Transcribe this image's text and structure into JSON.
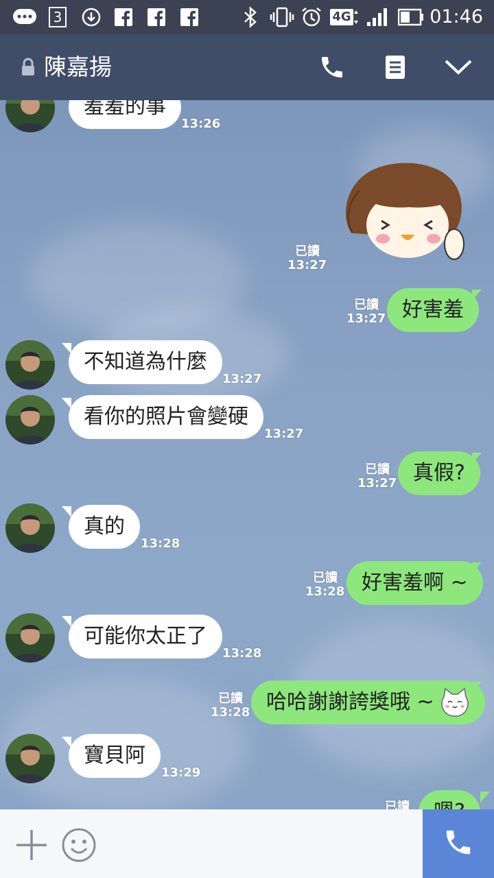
{
  "status_bar": {
    "time": "01:46",
    "network": "4G",
    "notification_count": "3",
    "icons": [
      "chat-icon",
      "sim-3-icon",
      "download-icon",
      "facebook-icon",
      "facebook-icon",
      "facebook-icon",
      "bluetooth-icon",
      "vibrate-icon",
      "alarm-icon",
      "network-4g-icon",
      "signal-icon",
      "battery-icon"
    ]
  },
  "header": {
    "contact_name": "陳嘉揚",
    "icons": [
      "lock-icon",
      "phone-icon",
      "note-icon",
      "chevron-down-icon"
    ]
  },
  "colors": {
    "header_bg": "#3f4d69",
    "status_bg": "#3b4254",
    "incoming_bubble": "#ffffff",
    "outgoing_bubble": "#8de77c",
    "call_button": "#5b86d8"
  },
  "messages": [
    {
      "from": "them",
      "text": "羞羞的事",
      "time": "13:26"
    },
    {
      "from": "me",
      "type": "sticker",
      "sticker": "shy-girl-sticker",
      "read": "已讀",
      "time": "13:27"
    },
    {
      "from": "me",
      "text": "好害羞",
      "read": "已讀",
      "time": "13:27"
    },
    {
      "from": "them",
      "text": "不知道為什麼",
      "time": "13:27"
    },
    {
      "from": "them",
      "text": "看你的照片會變硬",
      "time": "13:27"
    },
    {
      "from": "me",
      "text": "真假?",
      "read": "已讀",
      "time": "13:27"
    },
    {
      "from": "them",
      "text": "真的",
      "time": "13:28"
    },
    {
      "from": "me",
      "text": "好害羞啊 ~",
      "read": "已讀",
      "time": "13:28"
    },
    {
      "from": "them",
      "text": "可能你太正了",
      "time": "13:28"
    },
    {
      "from": "me",
      "text": "哈哈謝謝誇獎哦 ~",
      "emoji": "cat-emoji",
      "read": "已讀",
      "time": "13:28"
    },
    {
      "from": "them",
      "text": "寶貝阿",
      "time": "13:29"
    },
    {
      "from": "me",
      "text": "嗯?",
      "read": "已讀",
      "time": ""
    }
  ],
  "input_bar": {
    "icons": [
      "plus-icon",
      "emoji-icon",
      "phone-icon"
    ]
  }
}
